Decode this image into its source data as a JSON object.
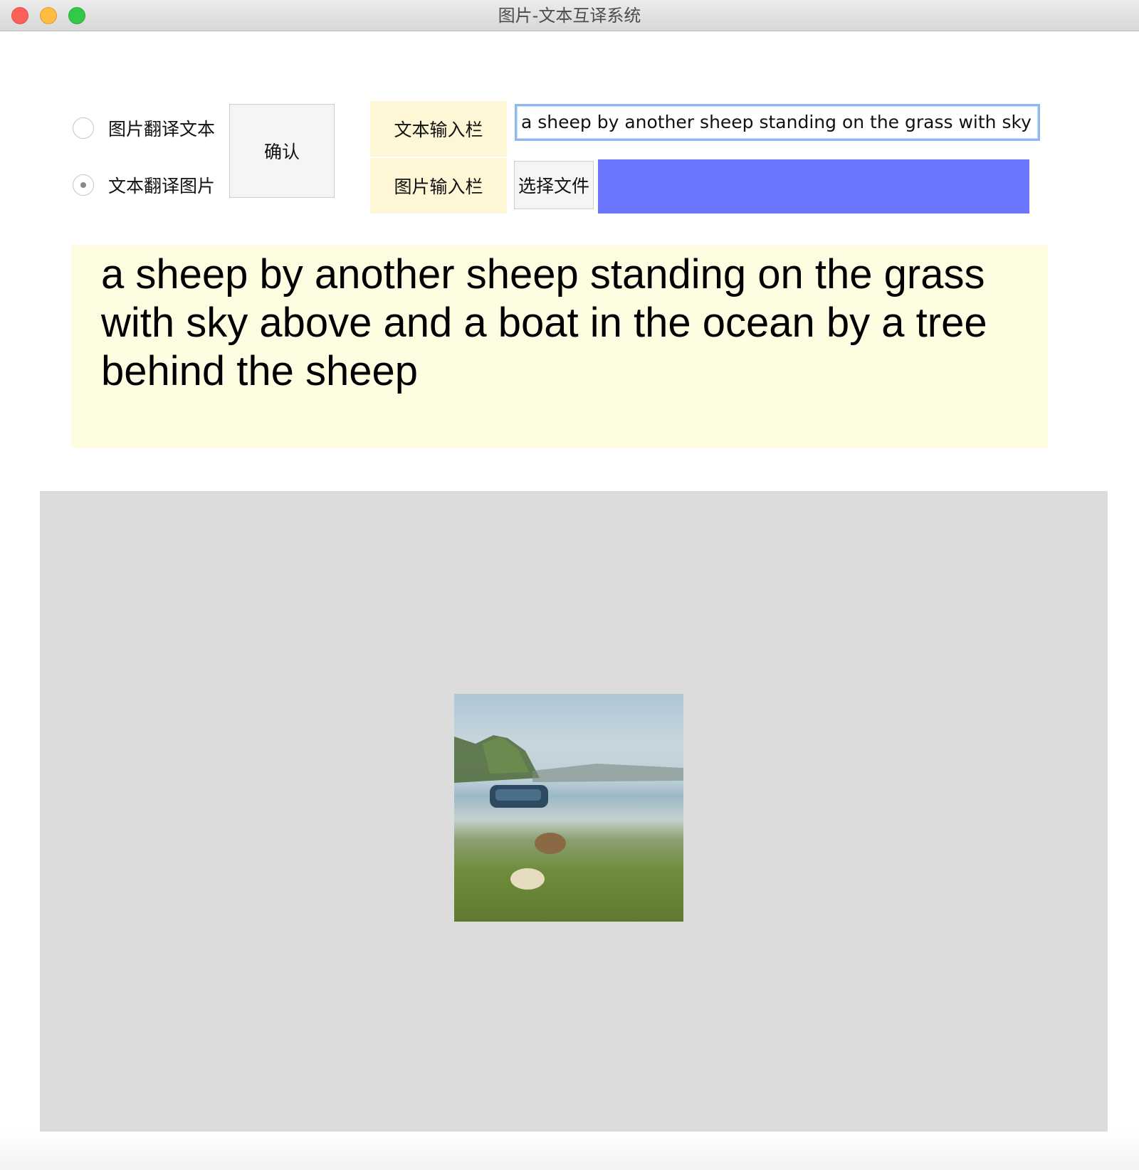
{
  "window": {
    "title": "图片-文本互译系统",
    "traffic_lights": [
      "close",
      "minimize",
      "zoom"
    ]
  },
  "mode": {
    "options": [
      {
        "label": "图片翻译文本",
        "selected": false
      },
      {
        "label": "文本翻译图片",
        "selected": true
      }
    ],
    "confirm_label": "确认"
  },
  "inputs": {
    "text_tag": "文本输入栏",
    "text_value": "a sheep by another sheep standing on the grass with sky",
    "image_tag": "图片输入栏",
    "choose_file_label": "选择文件",
    "file_bar_color": "#6b75fe"
  },
  "output": {
    "text": "a sheep by another sheep standing on the grass with sky above and a boat in the ocean by a tree behind the sheep"
  },
  "image_panel": {
    "image_name": "generated-image-sheep-boat-shore"
  },
  "colors": {
    "tag_bg": "#fff6d6",
    "output_bg": "#fefde2",
    "panel_bg": "#dcdcdc",
    "input_focus": "#8fb8ee"
  }
}
